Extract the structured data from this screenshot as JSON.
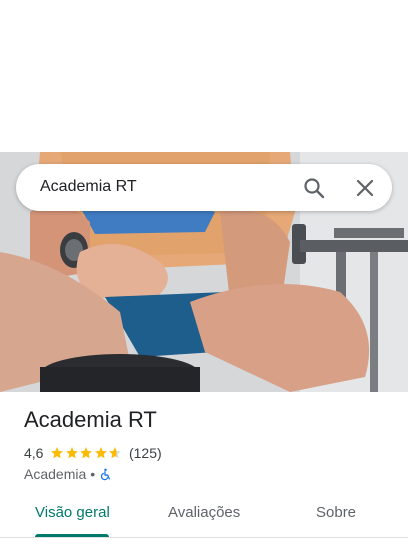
{
  "search": {
    "query": "Academia RT"
  },
  "place": {
    "name": "Academia RT",
    "rating": "4,6",
    "rating_value": 4.6,
    "review_count": "(125)",
    "category": "Academia",
    "separator": "•",
    "accessibility_icon": "wheelchair-icon"
  },
  "tabs": [
    {
      "label": "Visão geral",
      "active": true
    },
    {
      "label": "Avaliações",
      "active": false
    },
    {
      "label": "Sobre",
      "active": false
    }
  ],
  "colors": {
    "accent": "#00796b",
    "star": "#fbbc04",
    "accessibility": "#1a73e8"
  },
  "icons": [
    "search-icon",
    "close-icon",
    "star-icon",
    "wheelchair-icon"
  ]
}
